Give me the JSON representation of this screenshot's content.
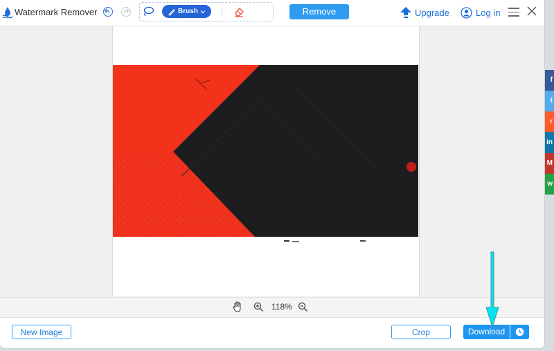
{
  "app": {
    "title": "Watermark Remover"
  },
  "toolbar": {
    "brush_label": "Brush",
    "remove_label": "Remove",
    "upgrade_label": "Upgrade",
    "login_label": "Log in"
  },
  "status": {
    "zoom": "118%"
  },
  "footer": {
    "new_image_label": "New Image",
    "crop_label": "Crop",
    "download_label": "Download"
  },
  "colors": {
    "accent": "#2f9cf0",
    "brush_active": "#2464d6",
    "link": "#1e6fd9",
    "arrow_annotation": "#00e5f0"
  },
  "share": {
    "items": [
      {
        "label": "f",
        "icon": "facebook-icon",
        "color": "#3b5998"
      },
      {
        "label": "t",
        "icon": "twitter-icon",
        "color": "#55acee"
      },
      {
        "label": "r",
        "icon": "reddit-icon",
        "color": "#ff5a28"
      },
      {
        "label": "in",
        "icon": "linkedin-icon",
        "color": "#0e76a8"
      },
      {
        "label": "M",
        "icon": "gmail-icon",
        "color": "#c0392b"
      },
      {
        "label": "w",
        "icon": "whatsapp-icon",
        "color": "#25a244"
      }
    ]
  }
}
